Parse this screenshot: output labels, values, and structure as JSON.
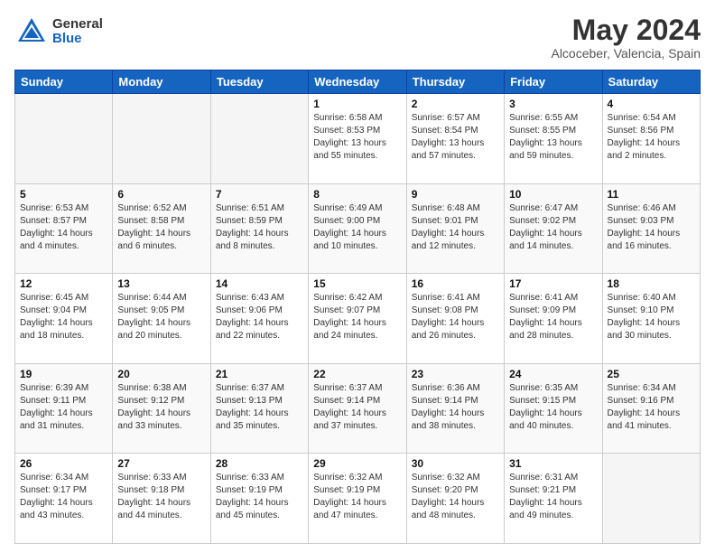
{
  "header": {
    "logo_general": "General",
    "logo_blue": "Blue",
    "month_title": "May 2024",
    "location": "Alcoceber, Valencia, Spain"
  },
  "weekdays": [
    "Sunday",
    "Monday",
    "Tuesday",
    "Wednesday",
    "Thursday",
    "Friday",
    "Saturday"
  ],
  "weeks": [
    [
      {
        "day": "",
        "info": ""
      },
      {
        "day": "",
        "info": ""
      },
      {
        "day": "",
        "info": ""
      },
      {
        "day": "1",
        "info": "Sunrise: 6:58 AM\nSunset: 8:53 PM\nDaylight: 13 hours\nand 55 minutes."
      },
      {
        "day": "2",
        "info": "Sunrise: 6:57 AM\nSunset: 8:54 PM\nDaylight: 13 hours\nand 57 minutes."
      },
      {
        "day": "3",
        "info": "Sunrise: 6:55 AM\nSunset: 8:55 PM\nDaylight: 13 hours\nand 59 minutes."
      },
      {
        "day": "4",
        "info": "Sunrise: 6:54 AM\nSunset: 8:56 PM\nDaylight: 14 hours\nand 2 minutes."
      }
    ],
    [
      {
        "day": "5",
        "info": "Sunrise: 6:53 AM\nSunset: 8:57 PM\nDaylight: 14 hours\nand 4 minutes."
      },
      {
        "day": "6",
        "info": "Sunrise: 6:52 AM\nSunset: 8:58 PM\nDaylight: 14 hours\nand 6 minutes."
      },
      {
        "day": "7",
        "info": "Sunrise: 6:51 AM\nSunset: 8:59 PM\nDaylight: 14 hours\nand 8 minutes."
      },
      {
        "day": "8",
        "info": "Sunrise: 6:49 AM\nSunset: 9:00 PM\nDaylight: 14 hours\nand 10 minutes."
      },
      {
        "day": "9",
        "info": "Sunrise: 6:48 AM\nSunset: 9:01 PM\nDaylight: 14 hours\nand 12 minutes."
      },
      {
        "day": "10",
        "info": "Sunrise: 6:47 AM\nSunset: 9:02 PM\nDaylight: 14 hours\nand 14 minutes."
      },
      {
        "day": "11",
        "info": "Sunrise: 6:46 AM\nSunset: 9:03 PM\nDaylight: 14 hours\nand 16 minutes."
      }
    ],
    [
      {
        "day": "12",
        "info": "Sunrise: 6:45 AM\nSunset: 9:04 PM\nDaylight: 14 hours\nand 18 minutes."
      },
      {
        "day": "13",
        "info": "Sunrise: 6:44 AM\nSunset: 9:05 PM\nDaylight: 14 hours\nand 20 minutes."
      },
      {
        "day": "14",
        "info": "Sunrise: 6:43 AM\nSunset: 9:06 PM\nDaylight: 14 hours\nand 22 minutes."
      },
      {
        "day": "15",
        "info": "Sunrise: 6:42 AM\nSunset: 9:07 PM\nDaylight: 14 hours\nand 24 minutes."
      },
      {
        "day": "16",
        "info": "Sunrise: 6:41 AM\nSunset: 9:08 PM\nDaylight: 14 hours\nand 26 minutes."
      },
      {
        "day": "17",
        "info": "Sunrise: 6:41 AM\nSunset: 9:09 PM\nDaylight: 14 hours\nand 28 minutes."
      },
      {
        "day": "18",
        "info": "Sunrise: 6:40 AM\nSunset: 9:10 PM\nDaylight: 14 hours\nand 30 minutes."
      }
    ],
    [
      {
        "day": "19",
        "info": "Sunrise: 6:39 AM\nSunset: 9:11 PM\nDaylight: 14 hours\nand 31 minutes."
      },
      {
        "day": "20",
        "info": "Sunrise: 6:38 AM\nSunset: 9:12 PM\nDaylight: 14 hours\nand 33 minutes."
      },
      {
        "day": "21",
        "info": "Sunrise: 6:37 AM\nSunset: 9:13 PM\nDaylight: 14 hours\nand 35 minutes."
      },
      {
        "day": "22",
        "info": "Sunrise: 6:37 AM\nSunset: 9:14 PM\nDaylight: 14 hours\nand 37 minutes."
      },
      {
        "day": "23",
        "info": "Sunrise: 6:36 AM\nSunset: 9:14 PM\nDaylight: 14 hours\nand 38 minutes."
      },
      {
        "day": "24",
        "info": "Sunrise: 6:35 AM\nSunset: 9:15 PM\nDaylight: 14 hours\nand 40 minutes."
      },
      {
        "day": "25",
        "info": "Sunrise: 6:34 AM\nSunset: 9:16 PM\nDaylight: 14 hours\nand 41 minutes."
      }
    ],
    [
      {
        "day": "26",
        "info": "Sunrise: 6:34 AM\nSunset: 9:17 PM\nDaylight: 14 hours\nand 43 minutes."
      },
      {
        "day": "27",
        "info": "Sunrise: 6:33 AM\nSunset: 9:18 PM\nDaylight: 14 hours\nand 44 minutes."
      },
      {
        "day": "28",
        "info": "Sunrise: 6:33 AM\nSunset: 9:19 PM\nDaylight: 14 hours\nand 45 minutes."
      },
      {
        "day": "29",
        "info": "Sunrise: 6:32 AM\nSunset: 9:19 PM\nDaylight: 14 hours\nand 47 minutes."
      },
      {
        "day": "30",
        "info": "Sunrise: 6:32 AM\nSunset: 9:20 PM\nDaylight: 14 hours\nand 48 minutes."
      },
      {
        "day": "31",
        "info": "Sunrise: 6:31 AM\nSunset: 9:21 PM\nDaylight: 14 hours\nand 49 minutes."
      },
      {
        "day": "",
        "info": ""
      }
    ]
  ]
}
